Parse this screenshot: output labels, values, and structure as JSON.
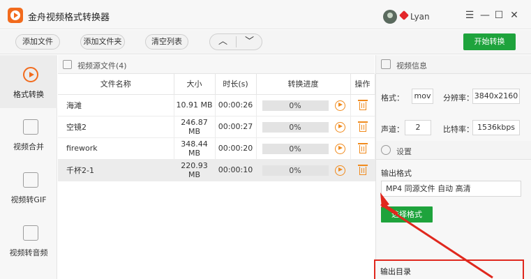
{
  "app": {
    "title": "金舟视频格式转换器",
    "username": "Lyan"
  },
  "window_controls": {
    "menu": "☰",
    "minimize": "—",
    "maximize": "☐",
    "close": "✕"
  },
  "toolbar": {
    "add_file": "添加文件",
    "add_folder": "添加文件夹",
    "clear_list": "清空列表",
    "move_up": "︿",
    "move_down": "﹀",
    "start_convert": "开始转换"
  },
  "nav": [
    {
      "label": "格式转换",
      "icon": "format-convert-icon",
      "active": true
    },
    {
      "label": "视频合并",
      "icon": "video-merge-icon",
      "active": false
    },
    {
      "label": "视频转GIF",
      "icon": "video-to-gif-icon",
      "active": false
    },
    {
      "label": "视频转音频",
      "icon": "video-to-audio-icon",
      "active": false
    }
  ],
  "file_panel": {
    "title": "视频源文件(4)",
    "columns": [
      "文件名称",
      "大小",
      "时长(s)",
      "转换进度",
      "操作"
    ],
    "rows": [
      {
        "name": "海滩",
        "size": "10.91 MB",
        "duration": "00:00:26",
        "progress": "0%",
        "selected": false
      },
      {
        "name": "空镜2",
        "size": "246.87 MB",
        "duration": "00:00:27",
        "progress": "0%",
        "selected": false
      },
      {
        "name": "firework",
        "size": "348.44 MB",
        "duration": "00:00:20",
        "progress": "0%",
        "selected": false
      },
      {
        "name": "千杯2-1",
        "size": "220.93 MB",
        "duration": "00:00:10",
        "progress": "0%",
        "selected": true
      }
    ]
  },
  "video_info": {
    "title": "视频信息",
    "format_label": "格式：",
    "format_value": "mov",
    "resolution_label": "分辨率：",
    "resolution_value": "3840x2160",
    "channel_label": "声道：",
    "channel_value": "2",
    "bitrate_label": "比特率：",
    "bitrate_value": "1536kbps"
  },
  "settings": {
    "title": "设置",
    "output_format_label": "输出格式",
    "output_format_value": "MP4 同源文件 自动 高清",
    "choose_format": "选择格式",
    "output_dir_label": "输出目录"
  },
  "colors": {
    "accent": "#f26b1d",
    "green": "#1ea33c",
    "annotation": "#e0281e"
  }
}
